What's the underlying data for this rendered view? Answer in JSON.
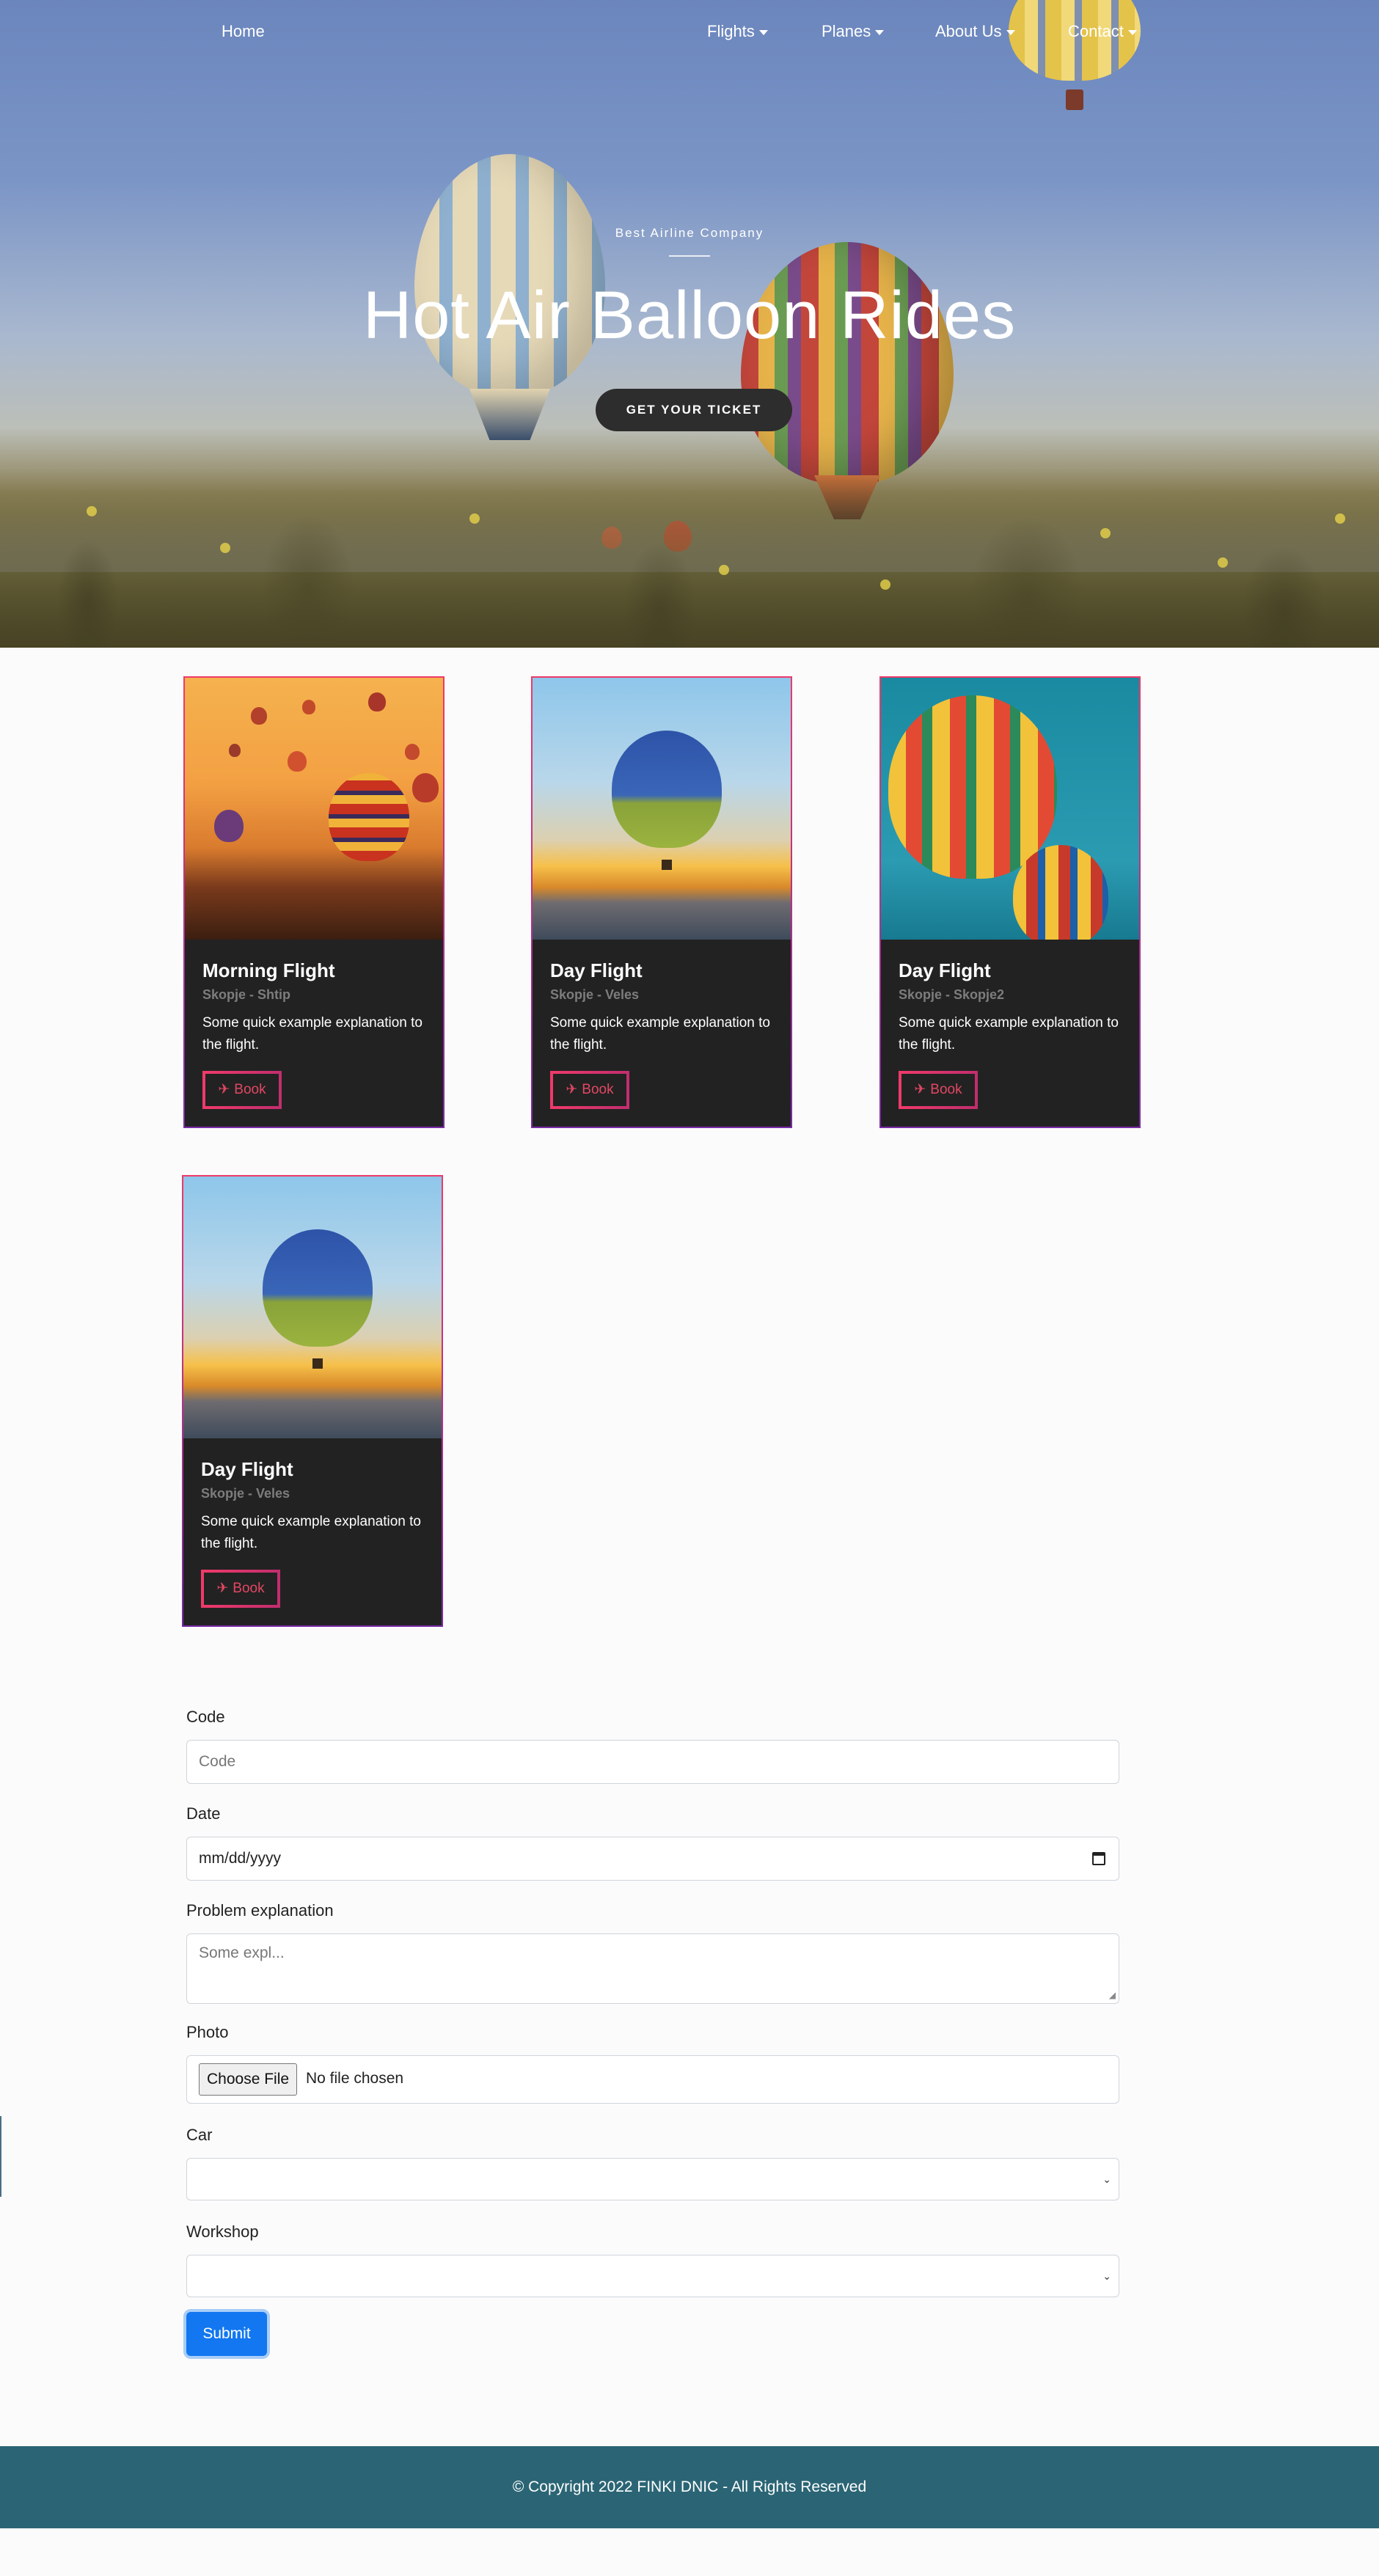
{
  "nav": {
    "home": "Home",
    "flights": "Flights",
    "planes": "Planes",
    "about": "About Us",
    "contact": "Contact"
  },
  "hero": {
    "subtitle": "Best Airline Company",
    "title": "Hot Air Balloon Rides",
    "cta": "GET YOUR TICKET"
  },
  "cards": [
    {
      "title": "Morning Flight",
      "route": "Skopje - Shtip",
      "desc": "Some quick example explanation to the flight.",
      "book": "Book"
    },
    {
      "title": "Day Flight",
      "route": "Skopje - Veles",
      "desc": "Some quick example explanation to the flight.",
      "book": "Book"
    },
    {
      "title": "Day Flight",
      "route": "Skopje - Skopje2",
      "desc": "Some quick example explanation to the flight.",
      "book": "Book"
    },
    {
      "title": "Day Flight",
      "route": "Skopje - Veles",
      "desc": "Some quick example explanation to the flight.",
      "book": "Book"
    }
  ],
  "form": {
    "code_label": "Code",
    "code_placeholder": "Code",
    "date_label": "Date",
    "date_placeholder": "mm/dd/yyyy",
    "problem_label": "Problem explanation",
    "problem_placeholder": "Some expl...",
    "photo_label": "Photo",
    "choose_file": "Choose File",
    "no_file": "No file chosen",
    "car_label": "Car",
    "car_value": "",
    "workshop_label": "Workshop",
    "workshop_value": "",
    "submit": "Submit"
  },
  "footer": {
    "text": "© Copyright 2022 FINKI DNIC - All Rights Reserved"
  },
  "colors": {
    "accent": "#e24763",
    "footer_bg": "#2b6575",
    "submit_bg": "#1277f0",
    "card_bg": "#222222"
  }
}
